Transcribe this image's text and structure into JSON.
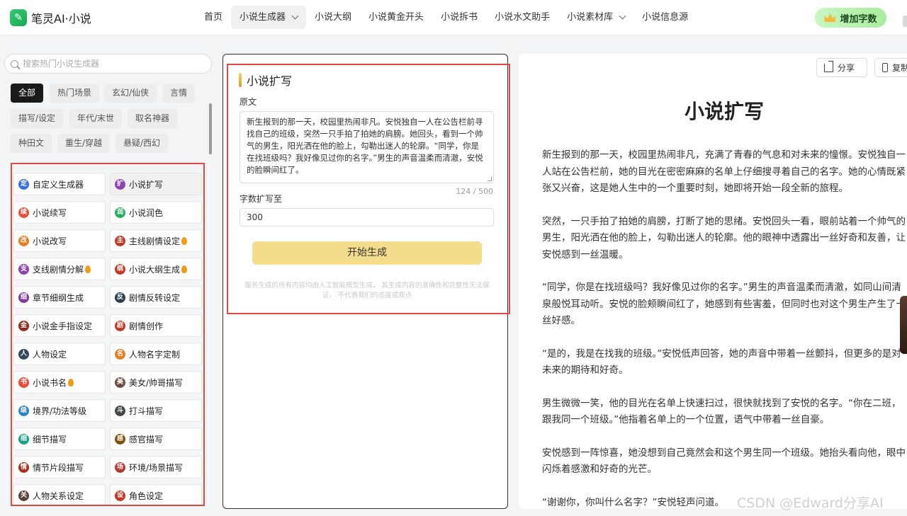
{
  "header": {
    "logo_text": "笔灵AI·小说",
    "nav": [
      "首页",
      "小说生成器",
      "小说大纲",
      "小说黄金开头",
      "小说拆书",
      "小说水文助手",
      "小说素材库",
      "小说信息源"
    ],
    "add_words_label": "增加字数"
  },
  "sidebar": {
    "search_placeholder": "搜索热门小说生成器",
    "tags": [
      "全部",
      "热门场景",
      "玄幻/仙侠",
      "言情",
      "描写/设定",
      "年代/末世",
      "取名神器",
      "种田文",
      "重生/穿越",
      "悬疑/西幻"
    ],
    "tools": [
      {
        "label": "自定义生成器",
        "icon_char": "定",
        "color": "#3b6fd8"
      },
      {
        "label": "小说扩写",
        "icon_char": "扩",
        "color": "#8e44ad"
      },
      {
        "label": "小说续写",
        "icon_char": "续",
        "color": "#e74c3c"
      },
      {
        "label": "小说润色",
        "icon_char": "润",
        "color": "#27ae60"
      },
      {
        "label": "小说改写",
        "icon_char": "改",
        "color": "#e67e22"
      },
      {
        "label": "主线剧情设定",
        "icon_char": "主",
        "color": "#c0392b"
      },
      {
        "label": "支线剧情分解",
        "icon_char": "支",
        "color": "#8e44ad"
      },
      {
        "label": "小说大纲生成",
        "icon_char": "纲",
        "color": "#c0392b"
      },
      {
        "label": "章节细纲生成",
        "icon_char": "细",
        "color": "#7d3c98"
      },
      {
        "label": "剧情反转设定",
        "icon_char": "反",
        "color": "#2c3e50"
      },
      {
        "label": "小说金手指设定",
        "icon_char": "金",
        "color": "#922b21"
      },
      {
        "label": "剧情创作",
        "icon_char": "剧",
        "color": "#c0392b"
      },
      {
        "label": "人物设定",
        "icon_char": "人",
        "color": "#34495e"
      },
      {
        "label": "人物名字定制",
        "icon_char": "名",
        "color": "#e67e22"
      },
      {
        "label": "小说书名",
        "icon_char": "书",
        "color": "#e74c3c"
      },
      {
        "label": "美女/帅哥描写",
        "icon_char": "美",
        "color": "#6d4c41"
      },
      {
        "label": "境界/功法等级",
        "icon_char": "级",
        "color": "#2e86c1"
      },
      {
        "label": "打斗描写",
        "icon_char": "斗",
        "color": "#424949"
      },
      {
        "label": "细节描写",
        "icon_char": "细",
        "color": "#16a085"
      },
      {
        "label": "感官描写",
        "icon_char": "感",
        "color": "#7e5109"
      },
      {
        "label": "情节片段描写",
        "icon_char": "情",
        "color": "#a93226"
      },
      {
        "label": "环境/场景描写",
        "icon_char": "场",
        "color": "#b03a2e"
      },
      {
        "label": "人物关系设定",
        "icon_char": "关",
        "color": "#5d4037"
      },
      {
        "label": "角色设定",
        "icon_char": "设",
        "color": "#c0392b"
      }
    ]
  },
  "form": {
    "title": "小说扩写",
    "source_label": "原文",
    "source_text": "新生报到的那一天，校园里热闹非凡。安悦独自一人在公告栏前寻找自己的班级，突然一只手拍了拍她的肩膀。她回头，看到一个帅气的男生，阳光洒在他的脸上，勾勒出迷人的轮廓。“同学，你是在找班级吗？我好像见过你的名字。”男生的声音温柔而清澈，安悦的脸瞬间红了。",
    "counter": "124 / 500",
    "expand_label": "字数扩写至",
    "expand_value": "300",
    "generate_label": "开始生成",
    "disclaimer": "服务生成的所有内容均由人工智能模型生成， 其生成内容的准确性和完整性无法保证， 不代表我们的态度或观点"
  },
  "result": {
    "share_label": "分享",
    "copy_label": "复制",
    "title": "小说扩写",
    "paragraphs": [
      "新生报到的那一天，校园里热闹非凡，充满了青春的气息和对未来的憧憬。安悦独自一人站在公告栏前，她的目光在密密麻麻的名单上仔细搜寻着自己的名字。她的心情既紧张又兴奋，这是她人生中的一个重要时刻，她即将开始一段全新的旅程。",
      "突然，一只手拍了拍她的肩膀，打断了她的思绪。安悦回头一看，眼前站着一个帅气的男生，阳光洒在他的脸上，勾勒出迷人的轮廓。他的眼神中透露出一丝好奇和友善，让安悦感到一丝温暖。",
      "“同学，你是在找班级吗？我好像见过你的名字。”男生的声音温柔而清澈，如同山间清泉般悦耳动听。安悦的脸颊瞬间红了，她感到有些害羞，但同时也对这个男生产生了一丝好感。",
      "“是的，我是在找我的班级。”安悦低声回答，她的声音中带着一丝颤抖，但更多的是对未来的期待和好奇。",
      "男生微微一笑，他的目光在名单上快速扫过，很快就找到了安悦的名字。“你在二班，跟我同一个班级。”他指着名单上的一个位置，语气中带着一丝自豪。",
      "安悦感到一阵惊喜，她没想到自己竟然会和这个男生同一个班级。她抬头看向他，眼中闪烁着感激和好奇的光芒。",
      "“谢谢你，你叫什么名字？”安悦轻声问道。"
    ]
  },
  "watermark": "CSDN @Edward分享AI",
  "colors": {
    "accent_green": "#a8ec9e",
    "highlight_red": "#e04848",
    "button_yellow": "#f3dc8c"
  }
}
